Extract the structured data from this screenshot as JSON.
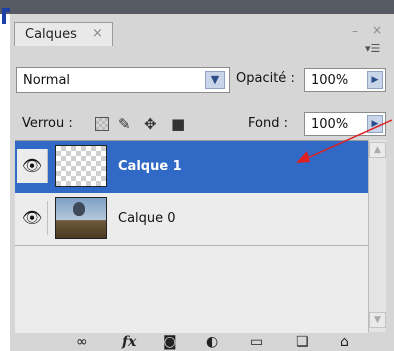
{
  "panel": {
    "tab_label": "Calques",
    "tab_close": "×",
    "minimize": "–",
    "close": "×",
    "menu": "▾☰"
  },
  "blend": {
    "mode": "Normal",
    "opacity_label": "Opacité :",
    "opacity_value": "100%"
  },
  "lock": {
    "label": "Verrou :",
    "fill_label": "Fond :",
    "fill_value": "100%"
  },
  "layers": [
    {
      "name": "Calque 1",
      "selected": true,
      "thumbnail": "transparent-checkerboard",
      "visible": true
    },
    {
      "name": "Calque 0",
      "selected": false,
      "thumbnail": "photo-balloon",
      "visible": true
    }
  ],
  "footer_icons": [
    "link-icon",
    "fx-icon",
    "mask-icon",
    "adjustment-icon",
    "group-folder-icon",
    "new-layer-icon",
    "trash-icon"
  ],
  "colors": {
    "selection": "#3169c6",
    "annotation_arrow": "#e02020"
  }
}
